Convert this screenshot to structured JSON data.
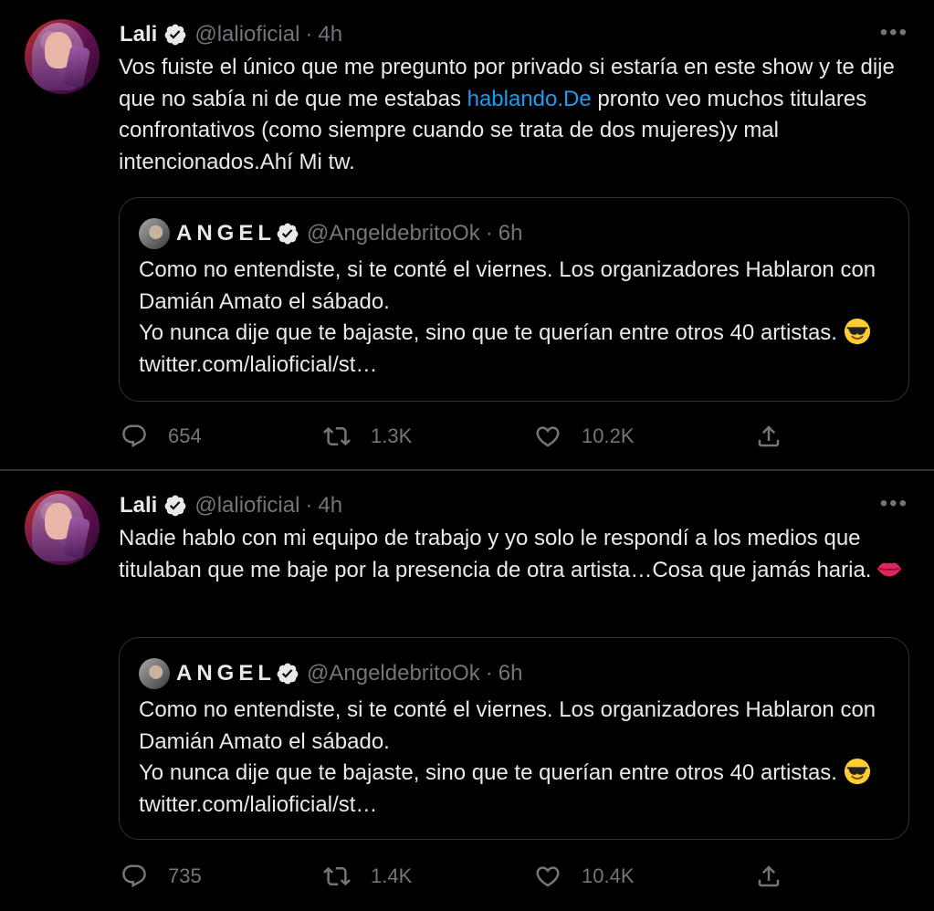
{
  "tweets": [
    {
      "author": {
        "name": "Lali",
        "handle": "@lalioficial",
        "time": "4h",
        "verified": true
      },
      "text_before_link": "Vos fuiste el único que me pregunto por privado si estaría en este show y te dije que no sabía ni de que me estabas ",
      "link_text": "hablando.De",
      "text_after_link": " pronto veo muchos titulares confrontativos (como siempre cuando se trata de dos mujeres)y mal intencionados.Ahí Mi tw.",
      "quoted": {
        "name": "ANGEL",
        "handle": "@AngeldebritoOk",
        "time": "6h",
        "text": "Como no entendiste, si te conté el viernes. Los organizadores Hablaron con Damián Amato el sábado.\nYo nunca dije que te bajaste, sino que te querían entre otros 40 artistas.",
        "emoji": "sunglasses-smiling-face",
        "url": "twitter.com/lalioficial/st…"
      },
      "stats": {
        "replies": "654",
        "retweets": "1.3K",
        "likes": "10.2K"
      }
    },
    {
      "author": {
        "name": "Lali",
        "handle": "@lalioficial",
        "time": "4h",
        "verified": true
      },
      "text": "Nadie hablo con mi equipo de trabajo y yo solo le respondí a los medios que titulaban que me baje por la presencia de otra artista…Cosa que jamás haria.",
      "text_emoji": "kiss-mark",
      "quoted": {
        "name": "ANGEL",
        "handle": "@AngeldebritoOk",
        "time": "6h",
        "text": "Como no entendiste, si te conté el viernes. Los organizadores Hablaron con Damián Amato el sábado.\nYo nunca dije que te bajaste, sino que te querían entre otros 40 artistas.",
        "emoji": "sunglasses-smiling-face",
        "url": "twitter.com/lalioficial/st…"
      },
      "stats": {
        "replies": "735",
        "retweets": "1.4K",
        "likes": "10.4K"
      }
    }
  ],
  "ui": {
    "dot_separator": "·",
    "more_label": "•••"
  },
  "colors": {
    "background": "#000000",
    "text": "#e7e9ea",
    "muted": "#71767b",
    "link": "#1d9bf0",
    "border": "#2f3336",
    "verified": "#ffffff"
  },
  "icons": [
    "verified-badge-icon",
    "more-icon",
    "reply-icon",
    "retweet-icon",
    "like-icon",
    "share-icon"
  ]
}
